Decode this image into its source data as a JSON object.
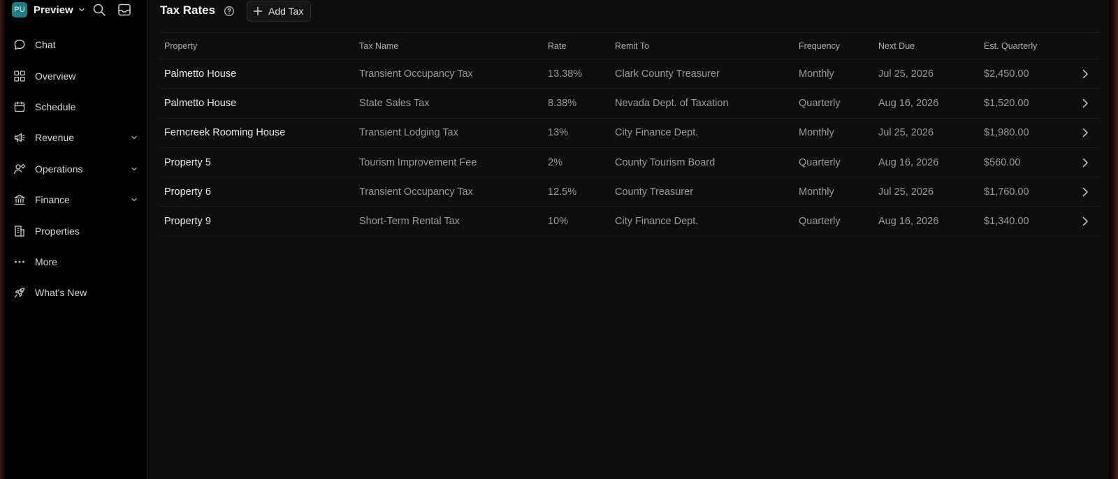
{
  "workspace": {
    "initials": "PU",
    "name": "Preview"
  },
  "sidebar": {
    "items": [
      {
        "label": "Chat",
        "icon": "chat-bubble-icon",
        "expandable": false
      },
      {
        "label": "Overview",
        "icon": "grid-icon",
        "expandable": false
      },
      {
        "label": "Schedule",
        "icon": "calendar-icon",
        "expandable": false
      },
      {
        "label": "Revenue",
        "icon": "megaphone-icon",
        "expandable": true
      },
      {
        "label": "Operations",
        "icon": "users-gear-icon",
        "expandable": true
      },
      {
        "label": "Finance",
        "icon": "bank-icon",
        "expandable": true
      },
      {
        "label": "Properties",
        "icon": "building-icon",
        "expandable": false
      },
      {
        "label": "More",
        "icon": "ellipsis-icon",
        "expandable": false
      },
      {
        "label": "What's New",
        "icon": "rocket-icon",
        "expandable": false
      }
    ]
  },
  "page": {
    "title": "Tax Rates",
    "add_button_label": "Add Tax"
  },
  "table": {
    "columns": [
      "Property",
      "Tax Name",
      "Rate",
      "Remit To",
      "Frequency",
      "Next Due",
      "Est. Quarterly"
    ],
    "rows": [
      [
        "Palmetto House",
        "Transient Occupancy Tax",
        "13.38%",
        "Clark County Treasurer",
        "Monthly",
        "Jul 25, 2026",
        "$2,450.00"
      ],
      [
        "Palmetto House",
        "State Sales Tax",
        "8.38%",
        "Nevada Dept. of Taxation",
        "Quarterly",
        "Aug 16, 2026",
        "$1,520.00"
      ],
      [
        "Ferncreek Rooming House",
        "Transient Lodging Tax",
        "13%",
        "City Finance Dept.",
        "Monthly",
        "Jul 25, 2026",
        "$1,980.00"
      ],
      [
        "Property 5",
        "Tourism Improvement Fee",
        "2%",
        "County Tourism Board",
        "Quarterly",
        "Aug 16, 2026",
        "$560.00"
      ],
      [
        "Property 6",
        "Transient Occupancy Tax",
        "12.5%",
        "County Treasurer",
        "Monthly",
        "Jul 25, 2026",
        "$1,760.00"
      ],
      [
        "Property 9",
        "Short-Term Rental Tax",
        "10%",
        "City Finance Dept.",
        "Quarterly",
        "Aug 16, 2026",
        "$1,340.00"
      ]
    ]
  },
  "colors": {
    "avatar": "#1e7e86",
    "main_bg": "#0e0e0e",
    "sidebar_bg": "#000000",
    "frame_accent": "#3a1a14"
  }
}
